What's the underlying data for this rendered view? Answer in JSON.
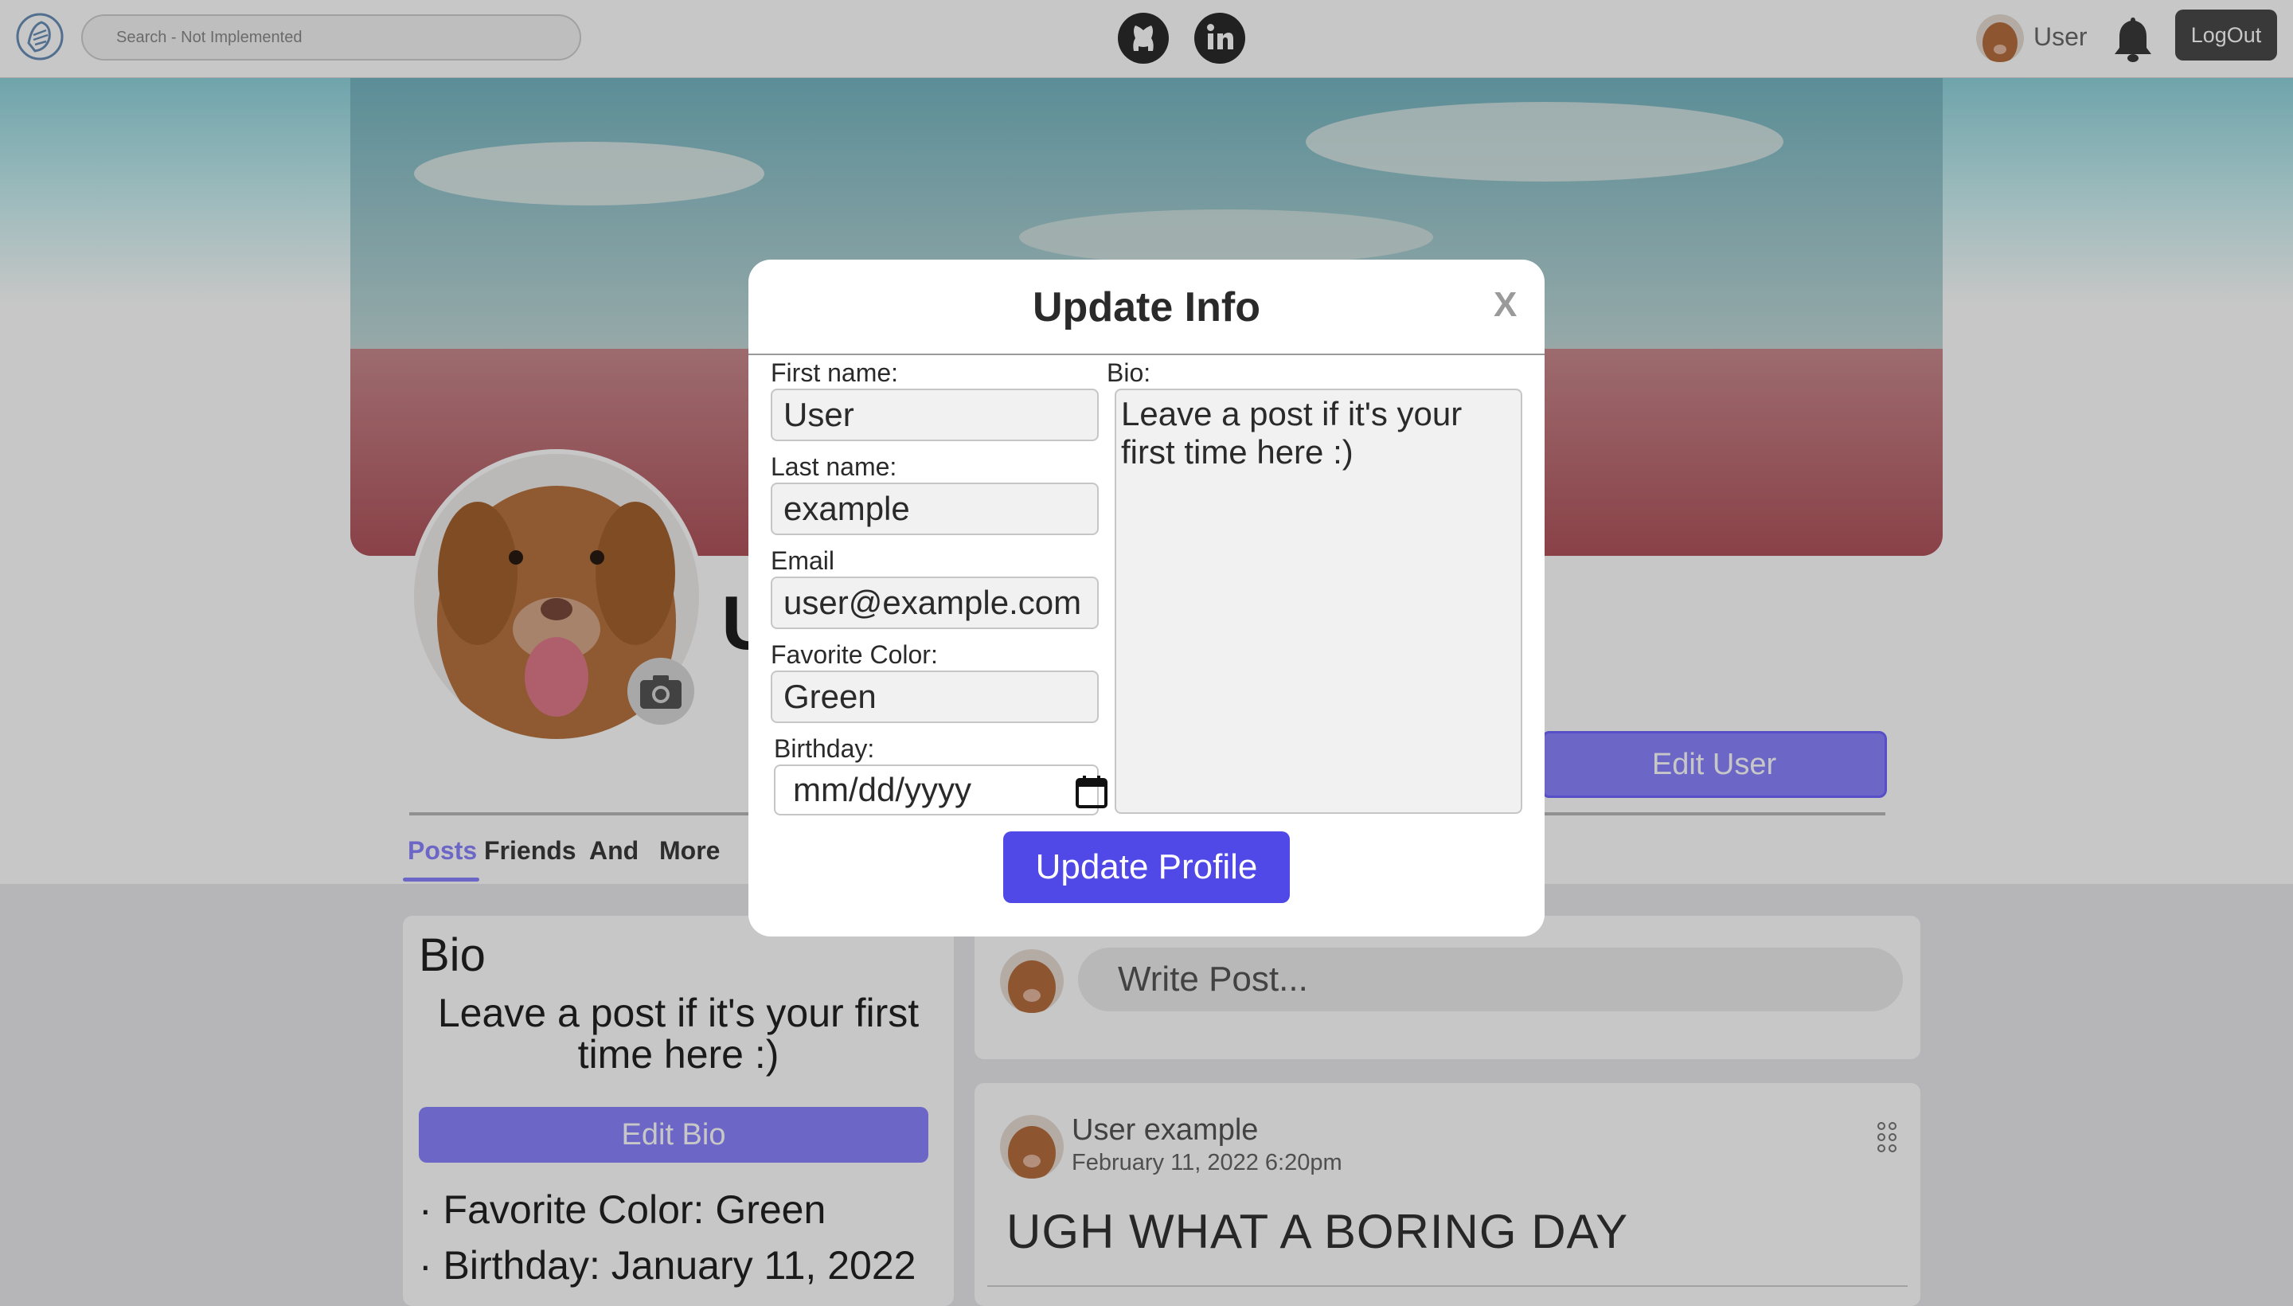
{
  "header": {
    "search_placeholder": "Search - Not Implemented",
    "user_name": "User",
    "logout_label": "LogOut"
  },
  "profile": {
    "name_partial": "U",
    "edit_user_label": "Edit User",
    "tabs": [
      {
        "label": "Posts",
        "active": true
      },
      {
        "label": "Friends",
        "active": false
      },
      {
        "label": "And",
        "active": false
      },
      {
        "label": "More",
        "active": false
      }
    ]
  },
  "bio_card": {
    "title": "Bio",
    "text": "Leave a post if it's your first time here :)",
    "edit_bio_label": "Edit Bio",
    "favorite_color_line": "· Favorite Color: Green",
    "birthday_line": "· Birthday: January 11, 2022"
  },
  "write_post": {
    "placeholder": "Write Post..."
  },
  "post": {
    "author": "User example",
    "date": "February 11, 2022 6:20pm",
    "body": "UGH WHAT A BORING DAY"
  },
  "modal": {
    "title": "Update Info",
    "close_label": "X",
    "first_name_label": "First name:",
    "first_name_value": "User",
    "last_name_label": "Last name:",
    "last_name_value": "example",
    "email_label": "Email",
    "email_value": "user@example.com",
    "favorite_color_label": "Favorite Color:",
    "favorite_color_value": "Green",
    "birthday_label": "Birthday:",
    "birthday_placeholder": "mm/dd/yyyy",
    "bio_label": "Bio:",
    "bio_value": "Leave a post if it's your first time here :)",
    "submit_label": "Update Profile"
  },
  "colors": {
    "accent": "#8b84ff",
    "primary_button": "#5148e8",
    "logout_bg": "#4a4a4a"
  },
  "icons": [
    "logo-icon",
    "github-icon",
    "linkedin-icon",
    "bell-icon",
    "camera-icon",
    "calendar-icon",
    "more-dots-icon"
  ]
}
